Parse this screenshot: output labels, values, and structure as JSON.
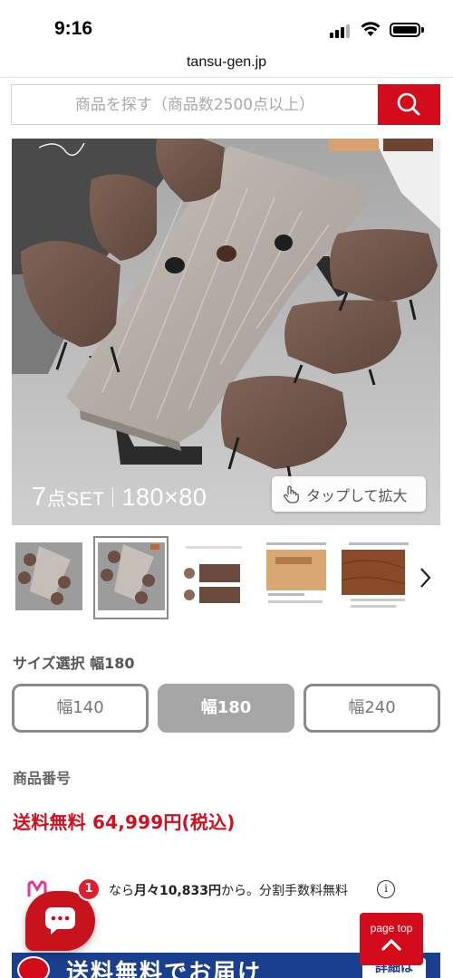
{
  "status_bar": {
    "time": "9:16"
  },
  "browser": {
    "url": "tansu-gen.jp"
  },
  "search": {
    "placeholder": "商品を探す（商品数2500点以上）"
  },
  "hero": {
    "caption_count": "7",
    "caption_unit": "点SET",
    "caption_size": "180×80",
    "zoom_label": "タップして拡大"
  },
  "thumbnails": [
    {
      "label": "table-set-photo-1",
      "selected": false
    },
    {
      "label": "table-set-photo-2",
      "selected": true
    },
    {
      "label": "size-diagram",
      "selected": false
    },
    {
      "label": "vintage-wood-detail",
      "selected": false
    },
    {
      "label": "wood-grain-closeup",
      "selected": false
    }
  ],
  "size_select": {
    "label": "サイズ選択 幅180",
    "options": [
      {
        "label": "幅140",
        "active": false
      },
      {
        "label": "幅180",
        "active": true
      },
      {
        "label": "幅240",
        "active": false
      }
    ]
  },
  "product": {
    "number_label": "商品番号",
    "price": "送料無料 64,999円(税込)"
  },
  "installment": {
    "prefix": "なら",
    "amount": "月々10,833円",
    "suffix": "から。分割手数料無料"
  },
  "chat": {
    "badge_count": "1"
  },
  "page_top": {
    "label": "page top"
  },
  "banner": {
    "text": "送料無料でお届け",
    "detail": "詳細は"
  },
  "colors": {
    "accent_red": "#d40b1a",
    "price_red": "#d0101f",
    "banner_blue": "#1a3f8f",
    "active_size_bg": "#a6a6a6"
  }
}
